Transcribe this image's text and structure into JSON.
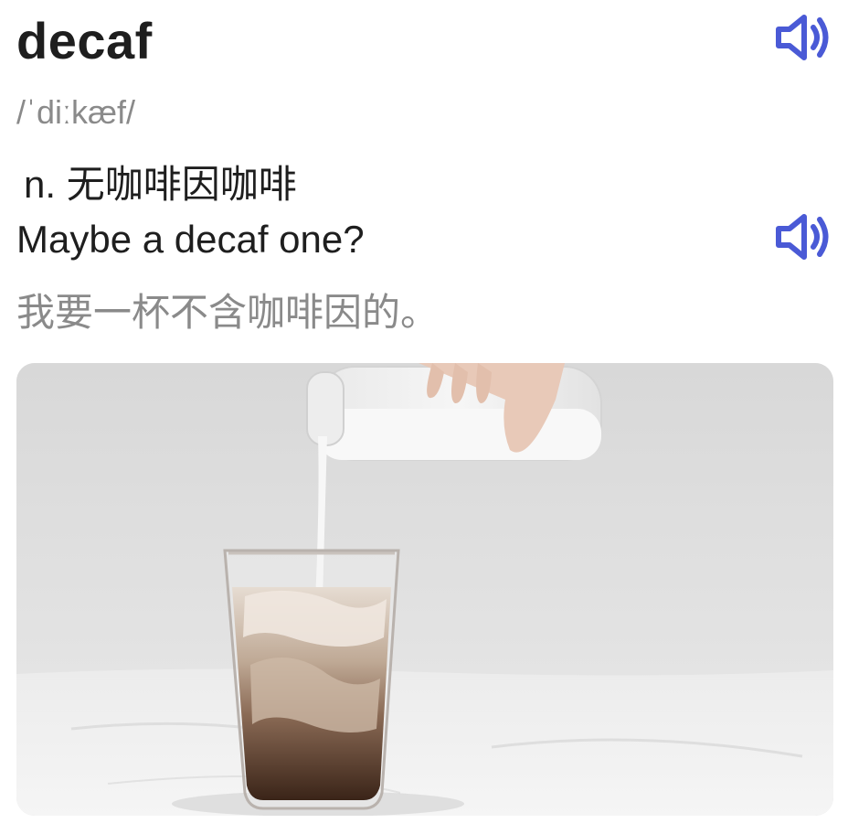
{
  "entry": {
    "word": "decaf",
    "phonetic": "/ˈdiːkæf/",
    "definition": "n. 无咖啡因咖啡",
    "example_en": "Maybe a decaf one?",
    "example_zh": "我要一杯不含咖啡因的。"
  },
  "icons": {
    "word_audio": "speaker-icon",
    "example_audio": "speaker-icon"
  },
  "colors": {
    "accent": "#4a5ad6",
    "text_primary": "#1e1e1e",
    "text_secondary": "#8a8a8a"
  },
  "image": {
    "subject": "iced-coffee-with-milk-photo"
  }
}
